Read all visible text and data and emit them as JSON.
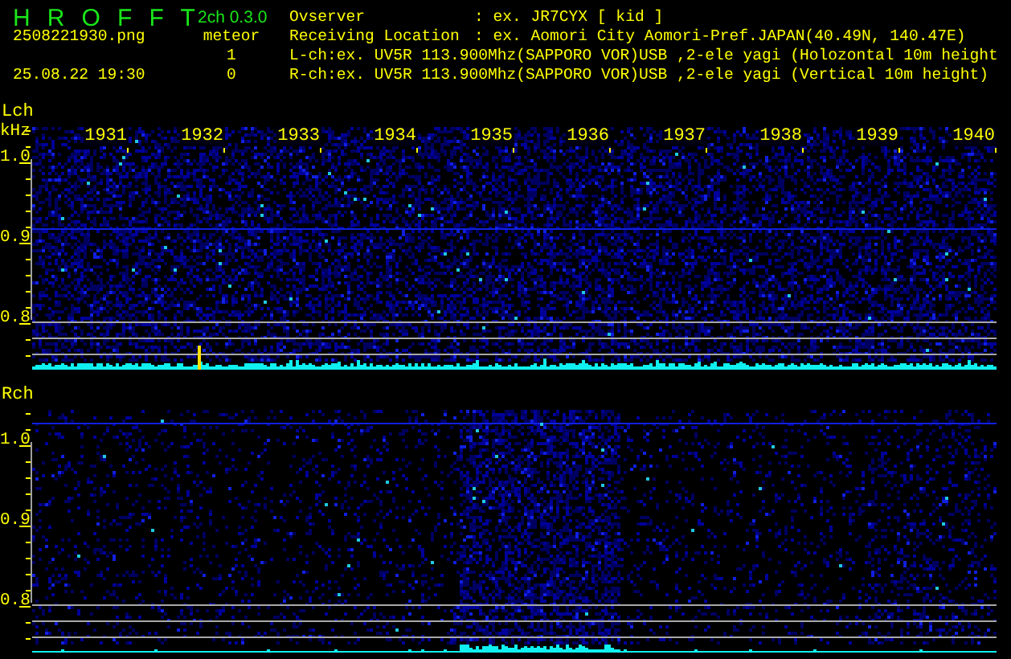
{
  "app": {
    "title": "H R O F F T",
    "version": "2ch 0.3.0"
  },
  "file": {
    "name": "2508221930.png",
    "datetime": "25.08.22 19:30"
  },
  "meteor": {
    "label": "meteor",
    "counts": [
      "1",
      "0"
    ]
  },
  "info": [
    {
      "kind": "field",
      "label": "Ovserver",
      "value": ": ex. JR7CYX [ kid ]"
    },
    {
      "kind": "field",
      "label": "Receiving Location",
      "value": ": ex. Aomori City Aomori-Pref.JAPAN(40.49N, 140.47E)"
    },
    {
      "kind": "line",
      "text": "L-ch:ex. UV5R 113.900Mhz(SAPPORO VOR)USB ,2-ele yagi (Holozontal 10m height"
    },
    {
      "kind": "line",
      "text": "R-ch:ex. UV5R 113.900Mhz(SAPPORO VOR)USB ,2-ele yagi (Vertical 10m height)"
    }
  ],
  "channels": [
    {
      "name": "Lch",
      "unit": "kHz",
      "time_labels": [
        "1931",
        "1932",
        "1933",
        "1934",
        "1935",
        "1936",
        "1937",
        "1938",
        "1939",
        "1940"
      ],
      "freq_labels": [
        "1.0",
        "0.9",
        "0.8"
      ]
    },
    {
      "name": "Rch",
      "freq_labels": [
        "1.0",
        "0.9",
        "0.8"
      ]
    }
  ]
}
